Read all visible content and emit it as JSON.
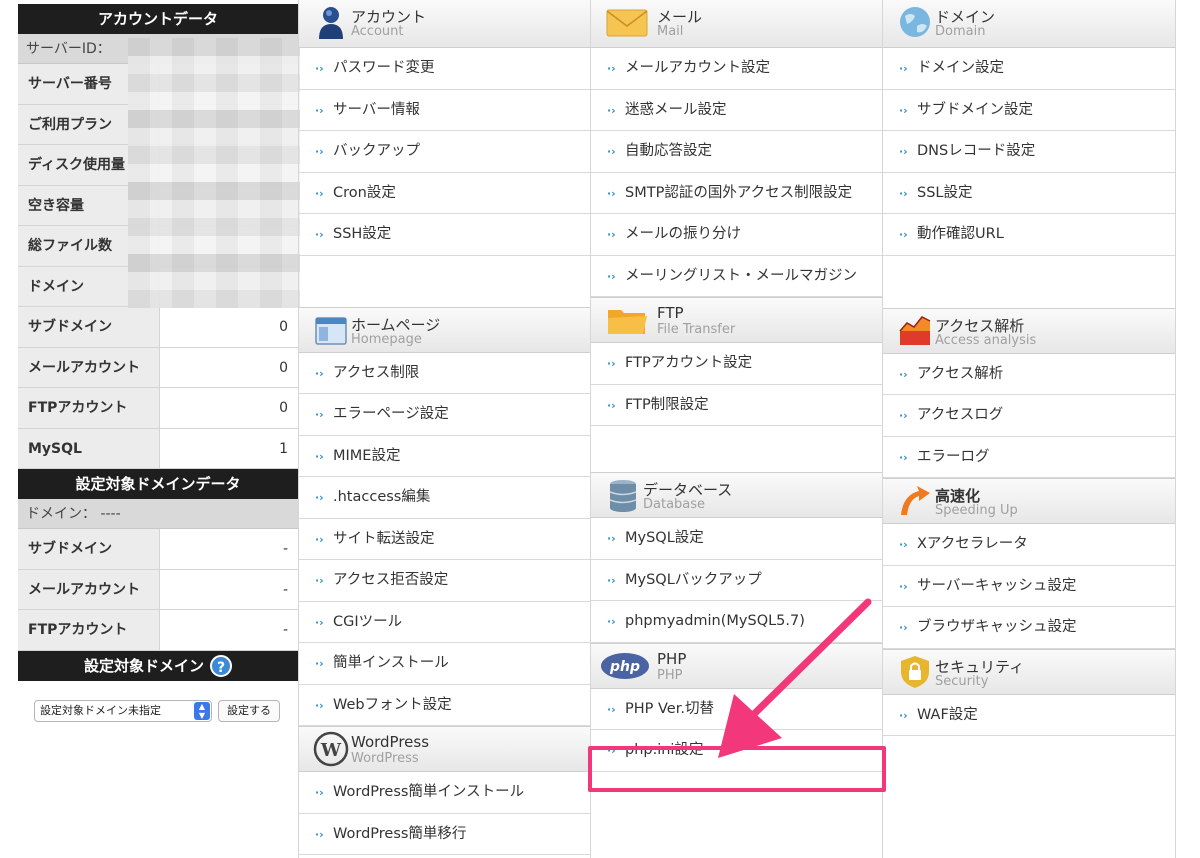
{
  "sidebar": {
    "account_title": "アカウントデータ",
    "server_id_label": "サーバーID：",
    "account_rows": [
      {
        "label": "サーバー番号",
        "value": ""
      },
      {
        "label": "ご利用プラン",
        "value": ""
      },
      {
        "label": "ディスク使用量",
        "value": ""
      },
      {
        "label": "空き容量",
        "value": ""
      },
      {
        "label": "総ファイル数",
        "value": ""
      },
      {
        "label": "ドメイン",
        "value": ""
      },
      {
        "label": "サブドメイン",
        "value": "0"
      },
      {
        "label": "メールアカウント",
        "value": "0"
      },
      {
        "label": "FTPアカウント",
        "value": "0"
      },
      {
        "label": "MySQL",
        "value": "1"
      }
    ],
    "domain_data_title": "設定対象ドメインデータ",
    "domain_label": "ドメイン： ----",
    "domain_rows": [
      {
        "label": "サブドメイン",
        "value": "-"
      },
      {
        "label": "メールアカウント",
        "value": "-"
      },
      {
        "label": "FTPアカウント",
        "value": "-"
      }
    ],
    "target_domain_title": "設定対象ドメイン",
    "help_icon": "?",
    "select_value": "設定対象ドメイン未指定",
    "set_button": "設定する"
  },
  "sections": {
    "account": {
      "jp": "アカウント",
      "en": "Account",
      "icon": "user-icon",
      "items": [
        "パスワード変更",
        "サーバー情報",
        "バックアップ",
        "Cron設定",
        "SSH設定"
      ]
    },
    "mail": {
      "jp": "メール",
      "en": "Mail",
      "icon": "envelope-icon",
      "items": [
        "メールアカウント設定",
        "迷惑メール設定",
        "自動応答設定",
        "SMTP認証の国外アクセス制限設定",
        "メールの振り分け",
        "メーリングリスト・メールマガジン"
      ]
    },
    "domain": {
      "jp": "ドメイン",
      "en": "Domain",
      "icon": "globe-icon",
      "items": [
        "ドメイン設定",
        "サブドメイン設定",
        "DNSレコード設定",
        "SSL設定",
        "動作確認URL"
      ]
    },
    "homepage": {
      "jp": "ホームページ",
      "en": "Homepage",
      "icon": "window-icon",
      "items": [
        "アクセス制限",
        "エラーページ設定",
        "MIME設定",
        ".htaccess編集",
        "サイト転送設定",
        "アクセス拒否設定",
        "CGIツール",
        "簡単インストール",
        "Webフォント設定"
      ]
    },
    "ftp": {
      "jp": "FTP",
      "en": "File Transfer",
      "icon": "folder-icon",
      "items": [
        "FTPアカウント設定",
        "FTP制限設定"
      ]
    },
    "access": {
      "jp": "アクセス解析",
      "en": "Access analysis",
      "icon": "chart-icon",
      "items": [
        "アクセス解析",
        "アクセスログ",
        "エラーログ"
      ]
    },
    "database": {
      "jp": "データベース",
      "en": "Database",
      "icon": "database-icon",
      "items": [
        "MySQL設定",
        "MySQLバックアップ",
        "phpmyadmin(MySQL5.7)"
      ]
    },
    "speed": {
      "jp": "高速化",
      "en": "Speeding Up",
      "icon": "speed-arrow-icon",
      "items": [
        "Xアクセラレータ",
        "サーバーキャッシュ設定",
        "ブラウザキャッシュ設定"
      ]
    },
    "php": {
      "jp": "PHP",
      "en": "PHP",
      "icon": "php-logo-icon",
      "badge": "php",
      "items": [
        "PHP Ver.切替",
        "php.ini設定"
      ]
    },
    "security": {
      "jp": "セキュリティ",
      "en": "Security",
      "icon": "lock-shield-icon",
      "items": [
        "WAF設定"
      ]
    },
    "wordpress": {
      "jp": "WordPress",
      "en": "WordPress",
      "icon": "wordpress-icon",
      "items": [
        "WordPress簡単インストール",
        "WordPress簡単移行"
      ]
    }
  },
  "colors": {
    "highlight": "#f2387a",
    "link_arrow": "#2f8fc9",
    "sidebar_header": "#1e1e1e"
  }
}
